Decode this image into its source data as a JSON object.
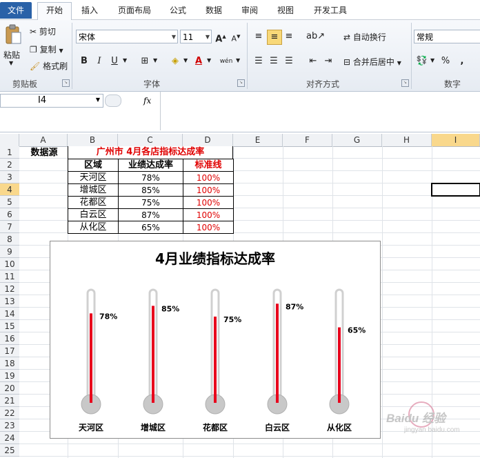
{
  "tabs": [
    "文件",
    "开始",
    "插入",
    "页面布局",
    "公式",
    "数据",
    "审阅",
    "视图",
    "开发工具"
  ],
  "ribbon": {
    "clipboard": {
      "paste": "粘贴",
      "cut": "剪切",
      "copy": "复制",
      "format_painter": "格式刷",
      "label": "剪贴板"
    },
    "font": {
      "name": "宋体",
      "size": "11",
      "bold": "B",
      "italic": "I",
      "underline": "U",
      "label": "字体"
    },
    "alignment": {
      "wrap": "自动换行",
      "merge": "合并后居中",
      "label": "对齐方式"
    },
    "number": {
      "format": "常规",
      "percent": "%",
      "comma": ",",
      "label": "数字"
    }
  },
  "formula_bar": {
    "name_box": "I4",
    "fx": "fx",
    "value": ""
  },
  "columns": [
    "A",
    "B",
    "C",
    "D",
    "E",
    "F",
    "G",
    "H",
    "I"
  ],
  "selected_column": "I",
  "rows": [
    "1",
    "2",
    "3",
    "4",
    "5",
    "6",
    "7",
    "8",
    "9",
    "10",
    "11",
    "12",
    "13",
    "14",
    "15",
    "16",
    "17",
    "18",
    "19",
    "20",
    "21",
    "22",
    "23",
    "24",
    "25"
  ],
  "selected_row": "4",
  "sheet": {
    "source_label": "数据源",
    "table_title": "广州市  4月各店指标达成率",
    "headers": [
      "区域",
      "业绩达成率",
      "标准线"
    ],
    "records": [
      [
        "天河区",
        "78%",
        "100%"
      ],
      [
        "增城区",
        "85%",
        "100%"
      ],
      [
        "花都区",
        "75%",
        "100%"
      ],
      [
        "白云区",
        "87%",
        "100%"
      ],
      [
        "从化区",
        "65%",
        "100%"
      ]
    ]
  },
  "chart_data": {
    "type": "bar",
    "title": "4月业绩指标达成率",
    "categories": [
      "天河区",
      "增城区",
      "花都区",
      "白云区",
      "从化区"
    ],
    "series": [
      {
        "values": [
          78,
          85,
          75,
          87,
          65
        ]
      },
      {
        "values": [
          100,
          100,
          100,
          100,
          100
        ]
      }
    ],
    "data_labels": [
      "78%",
      "85%",
      "75%",
      "87%",
      "65%"
    ],
    "ylim": [
      0,
      100
    ],
    "grid": false,
    "colors": {
      "fill": "#e8001c",
      "tube": "#d0d0d0",
      "bulb": "#c8c8c8"
    }
  },
  "watermark": {
    "text": "Baidu 经验",
    "sub": "jingyan.baidu.com"
  }
}
